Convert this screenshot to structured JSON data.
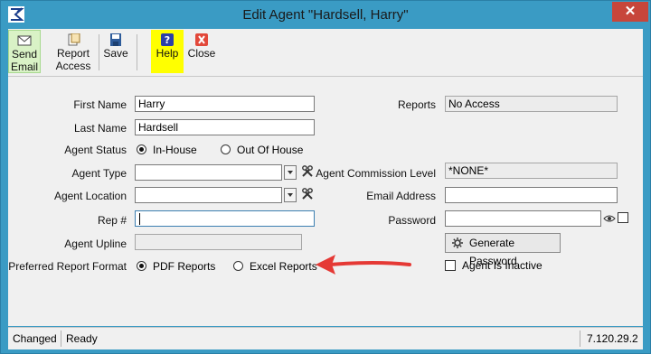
{
  "window": {
    "title": "Edit Agent \"Hardsell, Harry\"",
    "close_glyph": "✕"
  },
  "toolbar": {
    "buttons": [
      {
        "line1": "Send",
        "line2": "Email",
        "icon": "envelope-icon"
      },
      {
        "line1": "Report",
        "line2": "Access",
        "icon": "report-icon"
      },
      {
        "line1": "Save",
        "icon": "save-icon"
      },
      {
        "line1": "Help",
        "icon": "help-icon"
      },
      {
        "line1": "Close",
        "icon": "close-icon"
      }
    ]
  },
  "form": {
    "first_name": {
      "label": "First Name",
      "value": "Harry"
    },
    "last_name": {
      "label": "Last Name",
      "value": "Hardsell"
    },
    "agent_status": {
      "label": "Agent Status",
      "options": [
        "In-House",
        "Out Of House"
      ],
      "selected": "In-House"
    },
    "agent_type": {
      "label": "Agent Type",
      "value": ""
    },
    "agent_location": {
      "label": "Agent Location",
      "value": ""
    },
    "rep_number": {
      "label": "Rep #",
      "value": ""
    },
    "agent_upline": {
      "label": "Agent Upline",
      "value": ""
    },
    "preferred_report_format": {
      "label": "Preferred Report Format",
      "options": [
        "PDF Reports",
        "Excel Reports"
      ],
      "selected": "PDF Reports"
    },
    "reports": {
      "label": "Reports",
      "value": "No Access"
    },
    "agent_commission_level": {
      "label": "Agent Commission Level",
      "value": "*NONE*"
    },
    "email_address": {
      "label": "Email Address",
      "value": ""
    },
    "password": {
      "label": "Password",
      "value": ""
    },
    "generate_password": {
      "label": "Generate Password"
    },
    "agent_is_inactive": {
      "label": "Agent Is Inactive",
      "checked": false
    }
  },
  "status": {
    "changed": "Changed",
    "ready": "Ready",
    "version": "7.120.29.2"
  },
  "colors": {
    "title_bar": "#3a9bc4",
    "close_button": "#c7463b",
    "help_highlight": "#ffff00",
    "send_highlight": "#d9f2c6",
    "annotation_arrow": "#e53935"
  }
}
